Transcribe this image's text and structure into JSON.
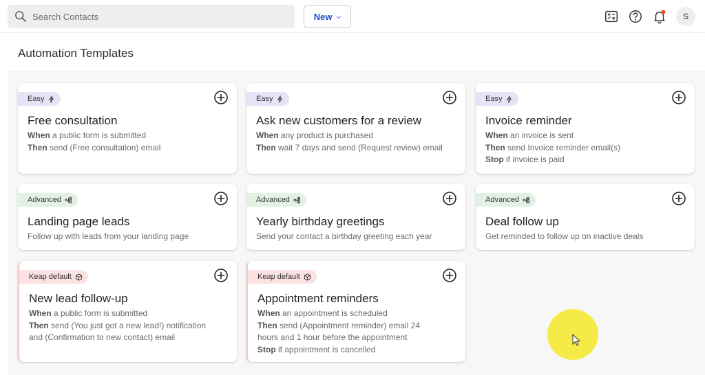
{
  "header": {
    "search_placeholder": "Search Contacts",
    "new_label": "New",
    "avatar_initial": "S"
  },
  "page": {
    "title": "Automation Templates"
  },
  "cards": [
    {
      "badge": "Easy",
      "badge_type": "easy",
      "title": "Free consultation",
      "lines": [
        {
          "bold": "When",
          "text": " a public form is submitted"
        },
        {
          "bold": "Then",
          "text": " send (Free consultation) email"
        }
      ]
    },
    {
      "badge": "Easy",
      "badge_type": "easy",
      "title": "Ask new customers for a review",
      "lines": [
        {
          "bold": "When",
          "text": " any product is purchased"
        },
        {
          "bold": "Then",
          "text": " wait 7 days and send (Request review) email"
        }
      ]
    },
    {
      "badge": "Easy",
      "badge_type": "easy",
      "title": "Invoice reminder",
      "lines": [
        {
          "bold": "When",
          "text": " an invoice is sent"
        },
        {
          "bold": "Then",
          "text": " send Invoice reminder email(s)"
        },
        {
          "bold": "Stop",
          "text": " if invoice is paid"
        }
      ]
    },
    {
      "badge": "Advanced",
      "badge_type": "adv",
      "title": "Landing page leads",
      "lines": [
        {
          "bold": "",
          "text": "Follow up with leads from your landing page"
        }
      ]
    },
    {
      "badge": "Advanced",
      "badge_type": "adv",
      "title": "Yearly birthday greetings",
      "lines": [
        {
          "bold": "",
          "text": "Send your contact a birthday greeting each year"
        }
      ]
    },
    {
      "badge": "Advanced",
      "badge_type": "adv",
      "title": "Deal follow up",
      "lines": [
        {
          "bold": "",
          "text": "Get reminded to follow up on inactive deals"
        }
      ]
    },
    {
      "badge": "Keap default",
      "badge_type": "keap",
      "title": "New lead follow-up",
      "lines": [
        {
          "bold": "When",
          "text": " a public form is submitted"
        },
        {
          "bold": "Then",
          "text": " send (You just got a new lead!) notification"
        },
        {
          "bold": "",
          "text": "and (Confirmation to new contact) email"
        }
      ]
    },
    {
      "badge": "Keap default",
      "badge_type": "keap",
      "title": "Appointment reminders",
      "lines": [
        {
          "bold": "When",
          "text": " an appointment is scheduled"
        },
        {
          "bold": "Then",
          "text": " send (Appointment reminder) email 24"
        },
        {
          "bold": "",
          "text": "hours and 1 hour before the appointment"
        },
        {
          "bold": "Stop",
          "text": " if appointment is cancelled"
        }
      ]
    }
  ]
}
